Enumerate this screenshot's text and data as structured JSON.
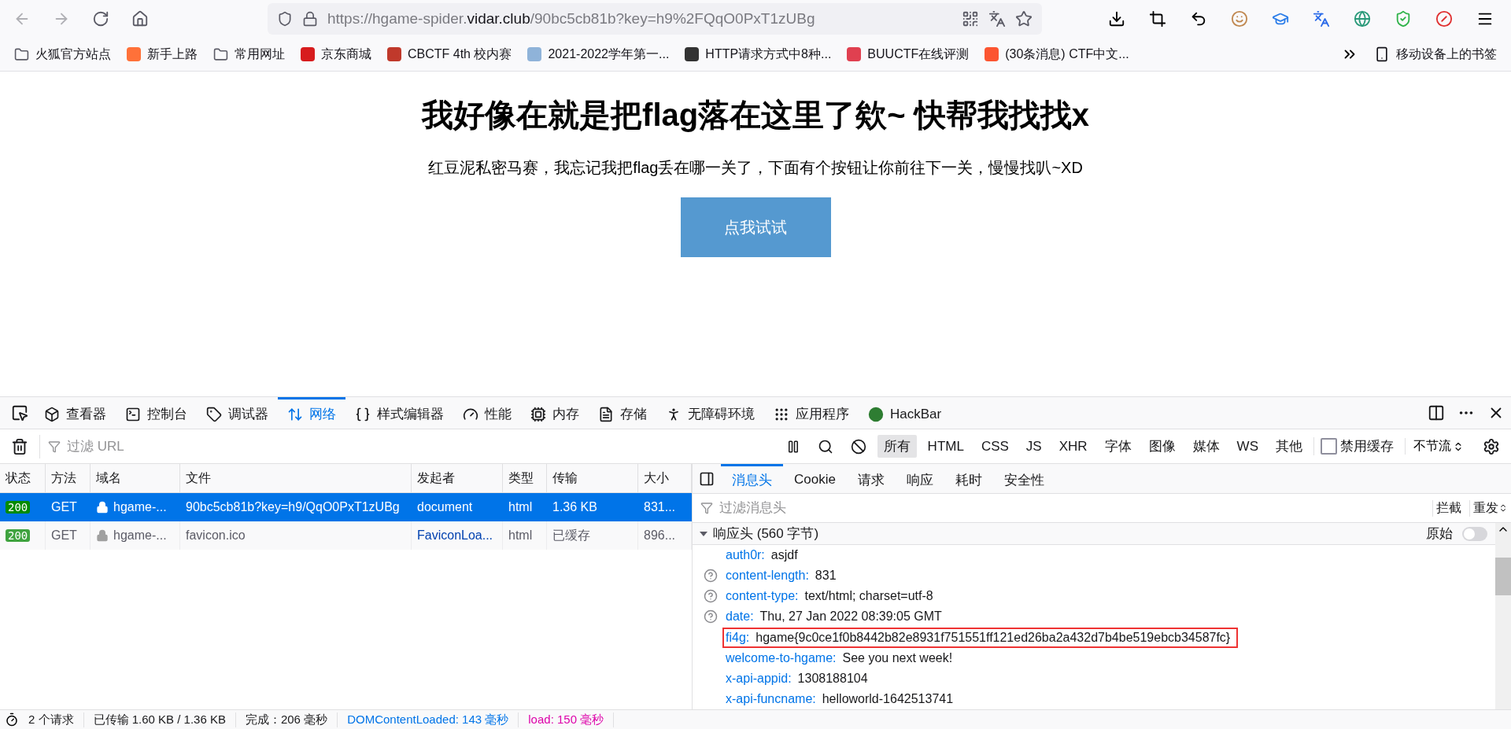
{
  "browser": {
    "url_prefix": "https://hgame-spider.",
    "url_host": "vidar.club",
    "url_path": "/90bc5cb81b?key=h9%2FQqO0PxT1zUBg",
    "bookmarked": false
  },
  "bookmarks": [
    {
      "label": "火狐官方站点",
      "kind": "folder"
    },
    {
      "label": "新手上路",
      "kind": "site",
      "color": "#ff7139"
    },
    {
      "label": "常用网址",
      "kind": "folder"
    },
    {
      "label": "京东商城",
      "kind": "site",
      "color": "#d71c1e"
    },
    {
      "label": "CBCTF 4th 校内赛",
      "kind": "site",
      "color": "#c0392b"
    },
    {
      "label": "2021-2022学年第一...",
      "kind": "site",
      "color": "#8fb3d9"
    },
    {
      "label": "HTTP请求方式中8种...",
      "kind": "site",
      "color": "#333333"
    },
    {
      "label": "BUUCTF在线评测",
      "kind": "site",
      "color": "#e04050"
    },
    {
      "label": "(30条消息) CTF中文...",
      "kind": "site",
      "color": "#fc5531"
    }
  ],
  "mobile_bookmarks": "移动设备上的书签",
  "page": {
    "title": "我好像在就是把flag落在这里了欸~ 快帮我找找x",
    "subtitle": "红豆泥私密马赛，我忘记我把flag丢在哪一关了，下面有个按钮让你前往下一关，慢慢找叭~XD",
    "button": "点我试试"
  },
  "devtools": {
    "tabs": [
      {
        "label": "查看器",
        "selected": false
      },
      {
        "label": "控制台",
        "selected": false
      },
      {
        "label": "调试器",
        "selected": false
      },
      {
        "label": "网络",
        "selected": true
      },
      {
        "label": "样式编辑器",
        "selected": false
      },
      {
        "label": "性能",
        "selected": false
      },
      {
        "label": "内存",
        "selected": false
      },
      {
        "label": "存储",
        "selected": false
      },
      {
        "label": "无障碍环境",
        "selected": false
      },
      {
        "label": "应用程序",
        "selected": false
      },
      {
        "label": "HackBar",
        "selected": false
      }
    ],
    "filter_placeholder": "过滤 URL",
    "type_filters": [
      {
        "label": "所有",
        "selected": true
      },
      {
        "label": "HTML",
        "selected": false
      },
      {
        "label": "CSS",
        "selected": false
      },
      {
        "label": "JS",
        "selected": false
      },
      {
        "label": "XHR",
        "selected": false
      },
      {
        "label": "字体",
        "selected": false
      },
      {
        "label": "图像",
        "selected": false
      },
      {
        "label": "媒体",
        "selected": false
      },
      {
        "label": "WS",
        "selected": false
      },
      {
        "label": "其他",
        "selected": false
      }
    ],
    "disable_cache": {
      "label": "禁用缓存",
      "checked": false
    },
    "throttle": "不节流",
    "table": {
      "columns": [
        "状态",
        "方法",
        "域名",
        "文件",
        "发起者",
        "类型",
        "传输",
        "大小"
      ],
      "rows": [
        {
          "status": "200",
          "method": "GET",
          "domain": "hgame-...",
          "file": "90bc5cb81b?key=h9/QqO0PxT1zUBg",
          "initiator": "document",
          "type": "html",
          "transferred": "1.36 KB",
          "size": "831...",
          "selected": true
        },
        {
          "status": "200",
          "method": "GET",
          "domain": "hgame-...",
          "file": "favicon.ico",
          "initiator": "FaviconLoa...",
          "type": "html",
          "transferred": "已缓存",
          "size": "896...",
          "selected": false
        }
      ]
    },
    "detail_tabs": [
      {
        "label": "消息头",
        "selected": true
      },
      {
        "label": "Cookie",
        "selected": false
      },
      {
        "label": "请求",
        "selected": false
      },
      {
        "label": "响应",
        "selected": false
      },
      {
        "label": "耗时",
        "selected": false
      },
      {
        "label": "安全性",
        "selected": false
      }
    ],
    "header_filter_placeholder": "过滤消息头",
    "actions": [
      "拦截",
      "重发"
    ],
    "section": {
      "title": "响应头 (560 字节)",
      "expanded": true,
      "raw_label": "原始",
      "raw_on": false
    },
    "headers": [
      {
        "name": "auth0r:",
        "value": "asjdf",
        "help": false,
        "highlighted": false
      },
      {
        "name": "content-length:",
        "value": "831",
        "help": true,
        "highlighted": false
      },
      {
        "name": "content-type:",
        "value": "text/html; charset=utf-8",
        "help": true,
        "highlighted": false
      },
      {
        "name": "date:",
        "value": "Thu, 27 Jan 2022 08:39:05 GMT",
        "help": true,
        "highlighted": false
      },
      {
        "name": "fi4g:",
        "value": "hgame{9c0ce1f0b8442b82e8931f751551ff121ed26ba2a432d7b4be519ebcb34587fc}",
        "help": false,
        "highlighted": true
      },
      {
        "name": "welcome-to-hgame:",
        "value": "See you next week!",
        "help": false,
        "highlighted": false
      },
      {
        "name": "x-api-appid:",
        "value": "1308188104",
        "help": false,
        "highlighted": false
      },
      {
        "name": "x-api-funcname:",
        "value": "helloworld-1642513741",
        "help": false,
        "highlighted": false
      }
    ],
    "status_bar": [
      {
        "text": "2 个请求",
        "kind": "plain"
      },
      {
        "text": "已传输 1.60 KB / 1.36 KB",
        "kind": "plain"
      },
      {
        "text": "完成：206 毫秒",
        "kind": "plain"
      },
      {
        "text": "DOMContentLoaded: 143 毫秒",
        "kind": "dom"
      },
      {
        "text": "load: 150 毫秒",
        "kind": "load"
      }
    ]
  }
}
